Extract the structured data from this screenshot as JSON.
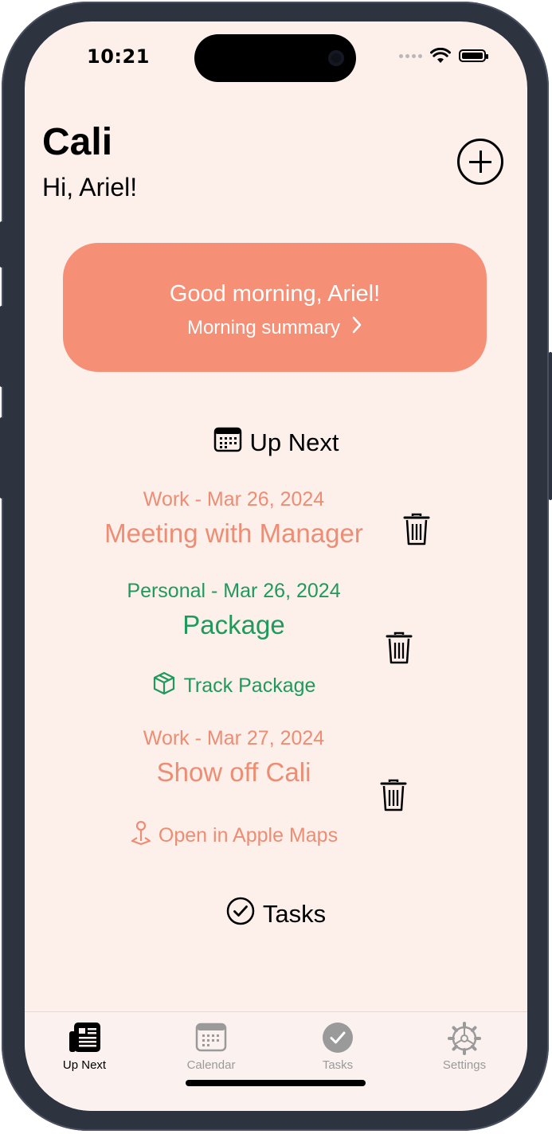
{
  "status_bar": {
    "time": "10:21"
  },
  "header": {
    "app_title": "Cali",
    "greeting": "Hi, Ariel!"
  },
  "summary_card": {
    "title": "Good morning, Ariel!",
    "link_label": "Morning summary",
    "color": "#f58f76"
  },
  "up_next": {
    "heading": "Up Next",
    "events": [
      {
        "meta": "Work - Mar 26, 2024",
        "title": "Meeting with Manager",
        "category": "Work",
        "color": "#ec8d74"
      },
      {
        "meta": "Personal - Mar 26, 2024",
        "title": "Package",
        "category": "Personal",
        "color": "#1f9a5c",
        "action_label": "Track Package",
        "action_icon": "package-icon"
      },
      {
        "meta": "Work - Mar 27, 2024",
        "title": "Show off Cali",
        "category": "Work",
        "color": "#ec8d74",
        "action_label": "Open in Apple Maps",
        "action_icon": "map-pin-icon"
      }
    ]
  },
  "tasks": {
    "heading": "Tasks"
  },
  "tab_bar": {
    "tabs": [
      {
        "label": "Up Next",
        "icon": "newspaper-icon",
        "active": true
      },
      {
        "label": "Calendar",
        "icon": "calendar-icon",
        "active": false
      },
      {
        "label": "Tasks",
        "icon": "checkmark-circle-icon",
        "active": false
      },
      {
        "label": "Settings",
        "icon": "gear-icon",
        "active": false
      }
    ]
  },
  "colors": {
    "background": "#fdefea",
    "work": "#ec8d74",
    "personal": "#1f9a5c"
  }
}
